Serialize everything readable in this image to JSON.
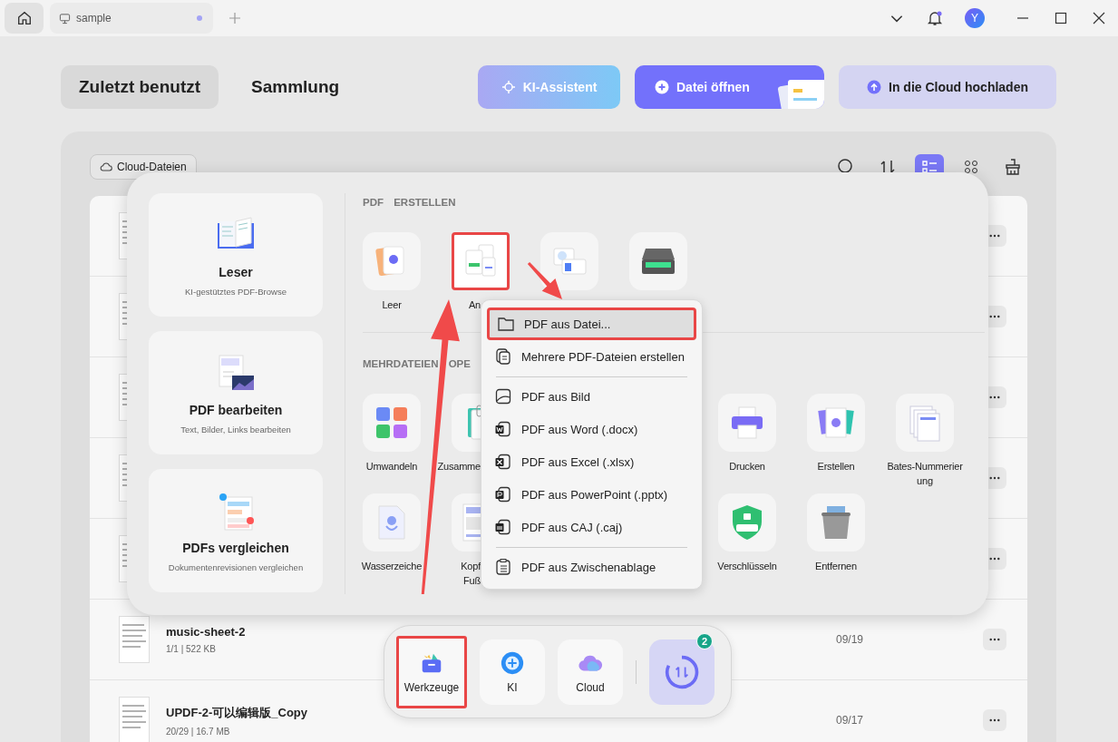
{
  "titlebar": {
    "tabs": [
      {
        "label": "sample",
        "unsaved": true
      }
    ],
    "notification": true,
    "avatar": "Y"
  },
  "nav": {
    "tabs": [
      {
        "label": "Zuletzt benutzt",
        "selected": true
      },
      {
        "label": "Sammlung",
        "selected": false
      }
    ],
    "actions": [
      {
        "kind": "ai",
        "label": "KI-Assistent"
      },
      {
        "kind": "open",
        "label": "Datei öffnen"
      },
      {
        "kind": "upload",
        "label": "In die Cloud hochladen"
      }
    ]
  },
  "files": {
    "filter": "Cloud-Dateien",
    "views": [
      {
        "kind": "search",
        "selected": false
      },
      {
        "kind": "sort",
        "selected": false
      },
      {
        "kind": "list",
        "selected": true
      },
      {
        "kind": "grid",
        "selected": false
      },
      {
        "kind": "clean",
        "selected": false
      }
    ],
    "rows": [
      {
        "kind": "covered"
      },
      {
        "kind": "covered"
      },
      {
        "kind": "covered"
      },
      {
        "kind": "covered"
      },
      {
        "kind": "covered"
      },
      {
        "kind": "file",
        "name": "music-sheet-2",
        "meta": "1/1 | 522 KB",
        "date": "09/19"
      },
      {
        "kind": "file",
        "name": "UPDF-2-可以编辑版_Copy",
        "meta": "20/29 | 16.7 MB",
        "date": "09/17"
      }
    ]
  },
  "tools_panel": {
    "features": [
      {
        "kind": "reader",
        "title": "Leser",
        "subtitle": "KI-gestütztes PDF-Browse"
      },
      {
        "kind": "edit",
        "title": "PDF bearbeiten",
        "subtitle": "Text, Bilder, Links bearbeiten"
      },
      {
        "kind": "compare",
        "title": "PDFs vergleichen",
        "subtitle": "Dokumentenrevisionen vergleichen"
      }
    ],
    "sections": [
      {
        "title": "PDF ERSTELLEN",
        "tools": [
          {
            "kind": "blank",
            "label": "Leer",
            "highlighted": false,
            "clipped": false
          },
          {
            "kind": "template",
            "label": "An",
            "highlighted": true,
            "clipped": true
          },
          {
            "kind": "idcard",
            "highlighted": false
          },
          {
            "kind": "scanner",
            "highlighted": false
          }
        ]
      },
      {
        "title": "MEHRDATEIEN OPE",
        "tools": [
          {
            "kind": "convert",
            "label": "Umwandeln",
            "highlighted": false,
            "clipped": false
          },
          {
            "kind": "merge",
            "label": "Zusamme",
            "highlighted": false,
            "clipped": true
          },
          {
            "kind": "covered"
          },
          {
            "kind": "covered"
          },
          {
            "kind": "print",
            "label": "Drucken",
            "highlighted": false,
            "clipped": false
          },
          {
            "kind": "create",
            "label": "Erstellen",
            "highlighted": false,
            "clipped": false
          },
          {
            "kind": "bates",
            "label": "Bates-Nummerierung",
            "highlighted": false,
            "clipped": false
          },
          {
            "kind": "watermark",
            "label": "Wasserzeiche",
            "highlighted": false,
            "clipped": false
          },
          {
            "kind": "headerfooter",
            "label": "Kopf Fuß",
            "highlighted": false,
            "clipped": true
          },
          {
            "kind": "covered"
          },
          {
            "kind": "covered"
          },
          {
            "kind": "encrypt",
            "label": "Verschlüsseln",
            "highlighted": false,
            "clipped": false
          },
          {
            "kind": "remove",
            "label": "Entfernen",
            "highlighted": false,
            "clipped": false
          }
        ]
      }
    ]
  },
  "context_menu": {
    "items": [
      {
        "kind": "folder",
        "label": "PDF aus Datei...",
        "selected": true,
        "highlighted": true
      },
      {
        "kind": "files",
        "label": "Mehrere PDF-Dateien erstellen",
        "selected": false,
        "highlighted": false
      },
      {
        "kind": "divider"
      },
      {
        "kind": "image",
        "label": "PDF aus Bild",
        "selected": false,
        "highlighted": false
      },
      {
        "kind": "word",
        "label": "PDF aus Word (.docx)",
        "selected": false,
        "highlighted": false
      },
      {
        "kind": "excel",
        "label": "PDF aus Excel (.xlsx)",
        "selected": false,
        "highlighted": false
      },
      {
        "kind": "powerpoint",
        "label": "PDF aus PowerPoint (.pptx)",
        "selected": false,
        "highlighted": false
      },
      {
        "kind": "caj",
        "label": "PDF aus CAJ (.caj)",
        "selected": false,
        "highlighted": false
      },
      {
        "kind": "divider"
      },
      {
        "kind": "clipboard",
        "label": "PDF aus Zwischenablage",
        "selected": false,
        "highlighted": false
      }
    ]
  },
  "dock": {
    "items": [
      {
        "kind": "tools",
        "label": "Werkzeuge",
        "highlighted": true
      },
      {
        "kind": "ai",
        "label": "KI",
        "highlighted": false
      },
      {
        "kind": "cloud",
        "label": "Cloud",
        "highlighted": false
      },
      {
        "kind": "transfer",
        "badge": "2",
        "highlighted": false
      }
    ]
  }
}
